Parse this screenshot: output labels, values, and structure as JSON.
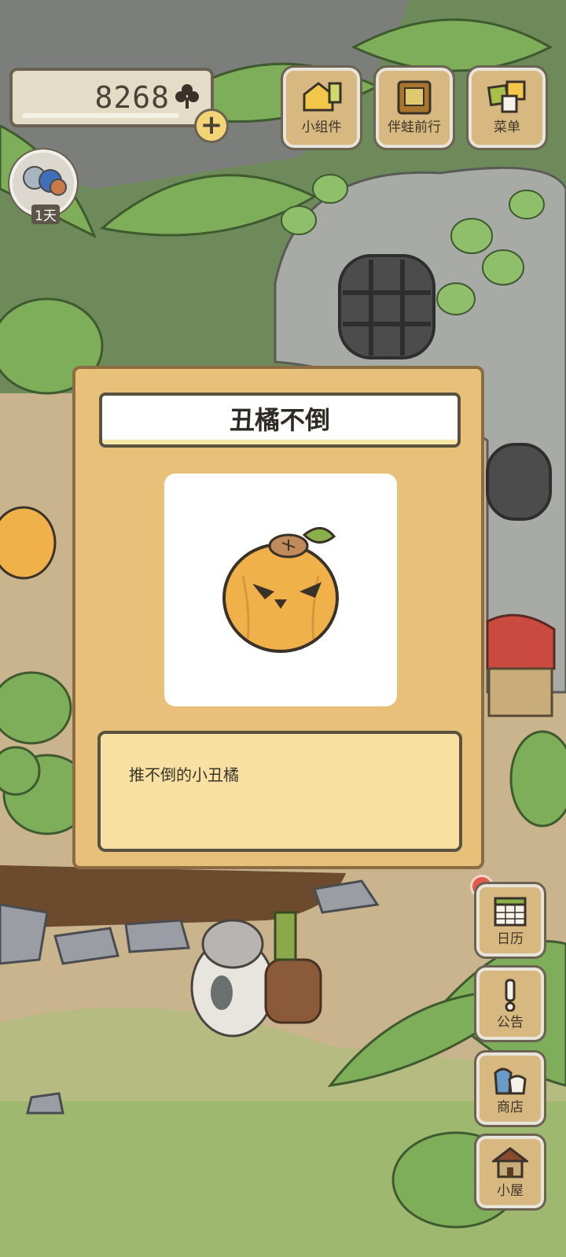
{
  "hud": {
    "clover_count": "8268",
    "plus_symbol": "+",
    "days_label": "1天"
  },
  "top_buttons": [
    {
      "label": "小组件",
      "icon": "widget-icon"
    },
    {
      "label": "伴蛙前行",
      "icon": "book-icon"
    },
    {
      "label": "菜单",
      "icon": "menu-icon"
    }
  ],
  "dialog": {
    "title": "丑橘不倒",
    "description": "推不倒的小丑橘",
    "item_icon": "grumpy-orange-icon"
  },
  "side_buttons": [
    {
      "label": "日历",
      "icon": "calendar-icon"
    },
    {
      "label": "公告",
      "icon": "exclamation-icon"
    },
    {
      "label": "商店",
      "icon": "shop-bag-icon"
    },
    {
      "label": "小屋",
      "icon": "house-icon"
    }
  ],
  "colors": {
    "panel": "#e8c07a",
    "panel_border": "#8b6c43",
    "desc_bg": "#f8e0a2",
    "orange": "#f0b04a",
    "notification": "#e25a4e"
  }
}
